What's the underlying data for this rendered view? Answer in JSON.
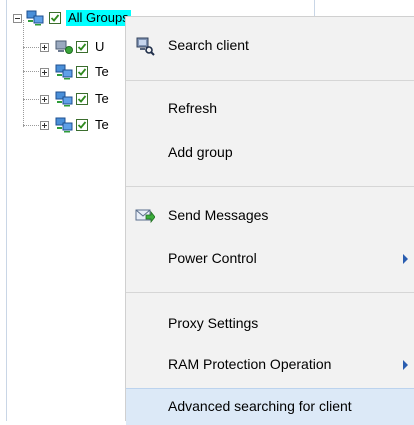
{
  "tree": {
    "root": {
      "label": "All Groups",
      "checked": true,
      "expanded": true
    },
    "children": [
      {
        "label": "U",
        "checked": true,
        "icon": "client-group-icon"
      },
      {
        "label": "Te",
        "checked": true,
        "icon": "group-icon"
      },
      {
        "label": "Te",
        "checked": true,
        "icon": "group-icon"
      },
      {
        "label": "Te",
        "checked": true,
        "icon": "group-icon"
      }
    ]
  },
  "menu": {
    "items": [
      {
        "id": "search-client",
        "label": "Search client",
        "icon": "search-client-icon",
        "submenu": false
      },
      {
        "id": "refresh",
        "label": "Refresh",
        "submenu": false
      },
      {
        "id": "add-group",
        "label": "Add group",
        "submenu": false
      },
      {
        "id": "send-messages",
        "label": "Send Messages",
        "icon": "send-message-icon",
        "submenu": false
      },
      {
        "id": "power-control",
        "label": "Power Control",
        "submenu": true
      },
      {
        "id": "proxy-settings",
        "label": "Proxy Settings",
        "submenu": false
      },
      {
        "id": "ram-protection-operation",
        "label": "RAM Protection Operation",
        "submenu": true
      },
      {
        "id": "advanced-searching",
        "label": "Advanced searching for client",
        "submenu": false,
        "highlighted": true
      }
    ]
  },
  "colors": {
    "selection": "#00ffff",
    "menu_bg": "#f2f2f2",
    "menu_highlight": "#dce9f7",
    "submenu_arrow": "#2a5db0"
  }
}
